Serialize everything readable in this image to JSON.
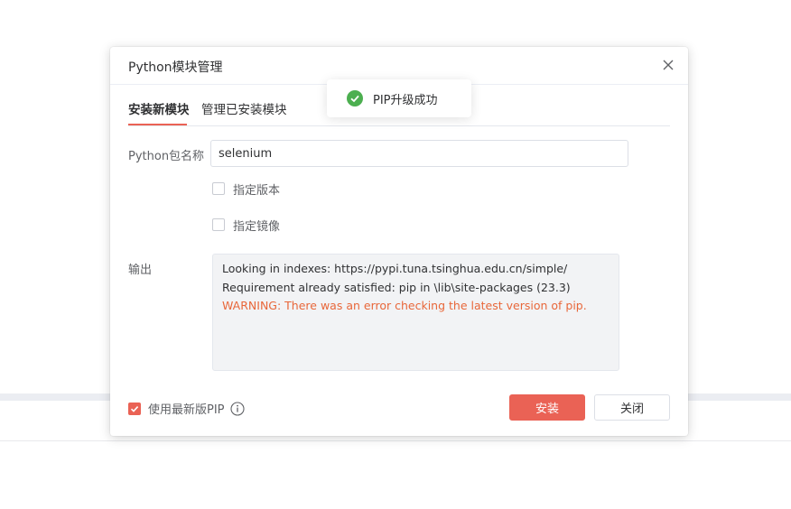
{
  "dialog": {
    "title": "Python模块管理",
    "close_icon": "close-icon"
  },
  "tabs": [
    {
      "label": "安装新模块",
      "active": true
    },
    {
      "label": "管理已安装模块",
      "active": false
    }
  ],
  "form": {
    "package_label": "Python包名称",
    "package_value": "selenium",
    "specify_version_label": "指定版本",
    "specify_version_checked": false,
    "specify_mirror_label": "指定镜像",
    "specify_mirror_checked": false,
    "output_label": "输出"
  },
  "output": {
    "lines": [
      {
        "text": "Looking in indexes: https://pypi.tuna.tsinghua.edu.cn/simple/",
        "type": "info"
      },
      {
        "text": "Requirement already satisfied: pip in \\lib\\site-packages (23.3)",
        "type": "info"
      },
      {
        "text": "WARNING: There was an error checking the latest version of pip.",
        "type": "warning"
      }
    ]
  },
  "footer": {
    "use_latest_pip_label": "使用最新版PIP",
    "use_latest_pip_checked": true,
    "info_icon": "info-icon",
    "install_button": "安装",
    "close_button": "关闭"
  },
  "toast": {
    "icon": "success-check-icon",
    "message": "PIP升级成功"
  },
  "colors": {
    "accent": "#ea6255",
    "success": "#4caf50",
    "warning_text": "#e8673a"
  }
}
